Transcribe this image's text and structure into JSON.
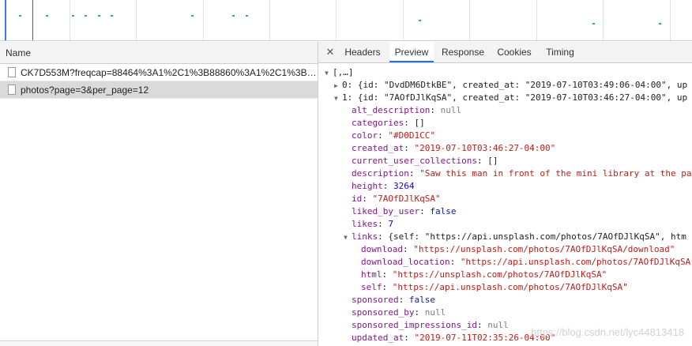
{
  "left_panel": {
    "column_header": "Name",
    "rows": [
      {
        "name": "CK7D553M?freqcap=88464%3A1%2C1%3B88860%3A1%2C1%3B88..."
      },
      {
        "name": "photos?page=3&per_page=12"
      }
    ]
  },
  "tabs": [
    "Headers",
    "Preview",
    "Response",
    "Cookies",
    "Timing"
  ],
  "active_tab": "Preview",
  "preview": {
    "root": "[,…]",
    "item0": "0: {id: \"DvdDM6DtkBE\", created_at: \"2019-07-10T03:49:06-04:00\", up",
    "item1_key": "1:",
    "item1_summary": "{id: \"7AOfDJlKqSA\", created_at: \"2019-07-10T03:46:27-04:00\", up",
    "fields": {
      "alt_description": "null",
      "categories": "[]",
      "color": "\"#D0D1CC\"",
      "created_at": "\"2019-07-10T03:46:27-04:00\"",
      "current_user_collections": "[]",
      "description": "\"Saw this man in front of the mini library at the pa",
      "height": "3264",
      "id": "\"7AOfDJlKqSA\"",
      "liked_by_user": "false",
      "likes": "7",
      "links_summary": "{self: \"https://api.unsplash.com/photos/7AOfDJlKqSA\", htm",
      "links": {
        "download": "\"https://unsplash.com/photos/7AOfDJlKqSA/download\"",
        "download_location": "\"https://api.unsplash.com/photos/7AOfDJlKqSA",
        "html": "\"https://unsplash.com/photos/7AOfDJlKqSA\"",
        "self": "\"https://api.unsplash.com/photos/7AOfDJlKqSA\""
      },
      "sponsored": "false",
      "sponsored_by": "null",
      "sponsored_impressions_id": "null",
      "updated_at": "\"2019-07-11T02:35:26-04:00\""
    }
  },
  "watermark": "https://blog.csdn.net/lyc44813418",
  "colors": {
    "key": "#881391",
    "string": "#c41a16",
    "number": "#1c00cf",
    "boolean": "#0d22aa",
    "active_tab_underline": "#1a73e8"
  }
}
